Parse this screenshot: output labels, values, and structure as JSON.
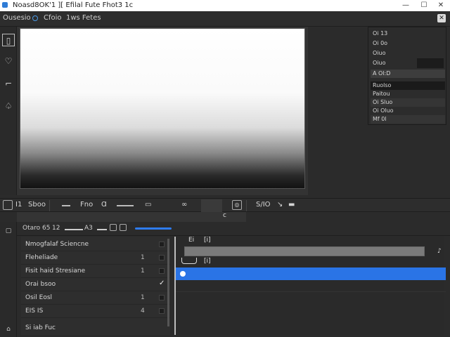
{
  "window": {
    "title": "Noasd8OK'1 ][ Efilal Fute Fhot3 1c",
    "minimize": "—",
    "maximize": "☐",
    "close": "✕"
  },
  "menubar": {
    "left_label": "Ousesio",
    "item2": "Cfoio",
    "item3": "1ws Fetes"
  },
  "tools": [
    "▯",
    "♡",
    "⌐",
    "♤"
  ],
  "right_panel": {
    "rows": [
      "Oi 13",
      "Oi 0o",
      "Oiuo",
      "Oiuo",
      "A Ol:D",
      "Ruolso",
      "Paitou",
      "Oi Sluo",
      "Oi Oluo",
      "Mf 0l"
    ]
  },
  "midbar": {
    "label1": "I1",
    "label2": "Sboo",
    "label3": "Fno",
    "label4": "Ɑ",
    "label5": "∞",
    "label6": "S/IO",
    "icon": "◎",
    "tool_g": "▭",
    "arrow": "↘",
    "small": "▬"
  },
  "subbar": {
    "text": "c"
  },
  "timeline": {
    "label": "Otaro",
    "val1": "65",
    "val2": "12",
    "text3": "A3"
  },
  "layers": [
    {
      "name": "Nmogfalaf Sciencne",
      "num": "",
      "box": ""
    },
    {
      "name": "Fleheliade",
      "num": "1",
      "box": ""
    },
    {
      "name": "Fisit haid Stresiane",
      "num": "1",
      "box": ""
    },
    {
      "name": "Orai bsoo",
      "num": "",
      "box": "✓"
    },
    {
      "name": "Osil Eosl",
      "num": "1",
      "box": ""
    },
    {
      "name": "EIS IS",
      "num": "4",
      "box": ""
    },
    {
      "name": "Si iab Fuc",
      "num": "",
      "box": ""
    }
  ],
  "tracks": {
    "label1": "Ei",
    "label2": "[i]",
    "label3": "[i]",
    "end_icon": "♪"
  },
  "colors": {
    "accent": "#2a74e6",
    "titlebar": "#ffffff",
    "panel": "#2b2b2b"
  }
}
